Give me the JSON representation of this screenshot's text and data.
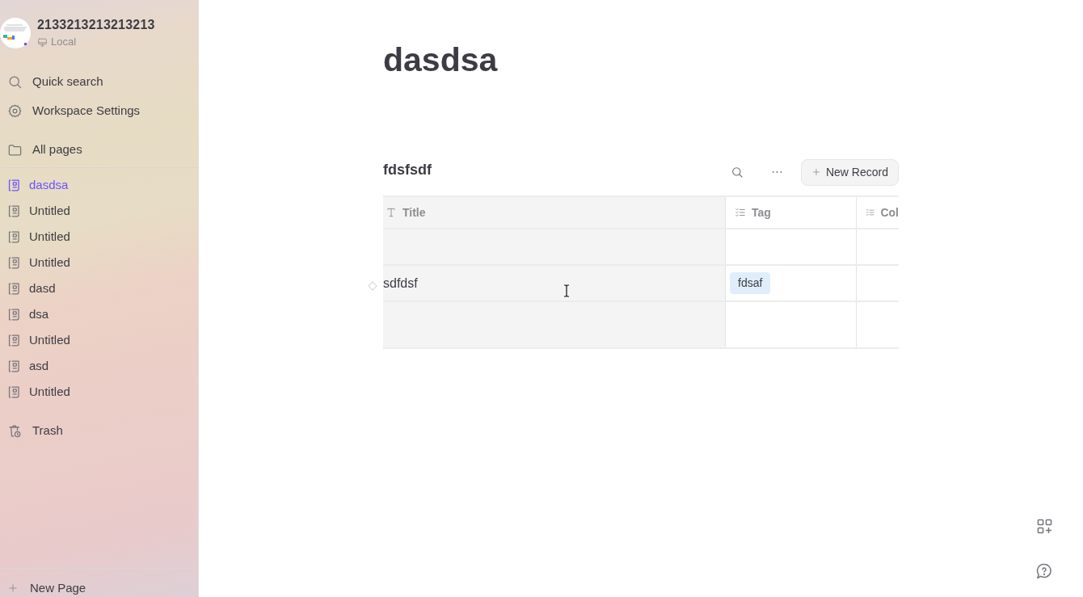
{
  "sidebar": {
    "workspace": {
      "name": "2133213213213213",
      "storage": "Local"
    },
    "nav": [
      {
        "label": "Quick search",
        "kind": "search"
      },
      {
        "label": "Workspace Settings",
        "kind": "settings"
      },
      {
        "label": "All pages",
        "kind": "folder"
      }
    ],
    "pages": [
      {
        "title": "dasdsa",
        "selected": true
      },
      {
        "title": "Untitled",
        "selected": false
      },
      {
        "title": "Untitled",
        "selected": false
      },
      {
        "title": "Untitled",
        "selected": false
      },
      {
        "title": "dasd",
        "selected": false
      },
      {
        "title": "dsa",
        "selected": false
      },
      {
        "title": "Untitled",
        "selected": false
      },
      {
        "title": "asd",
        "selected": false
      },
      {
        "title": "Untitled",
        "selected": false
      }
    ],
    "trash": "Trash",
    "new_page": "New Page"
  },
  "page": {
    "title": "dasdsa",
    "database": {
      "title": "fdsfsdf",
      "new_record": "New Record",
      "columns": [
        {
          "label": "Title",
          "kind": "text"
        },
        {
          "label": "Tag",
          "kind": "select"
        },
        {
          "label": "Col",
          "kind": "select"
        }
      ],
      "rows": [
        {},
        {
          "title": "sdfdsf",
          "tags": [
            "fdsaf"
          ]
        },
        {}
      ]
    }
  }
}
